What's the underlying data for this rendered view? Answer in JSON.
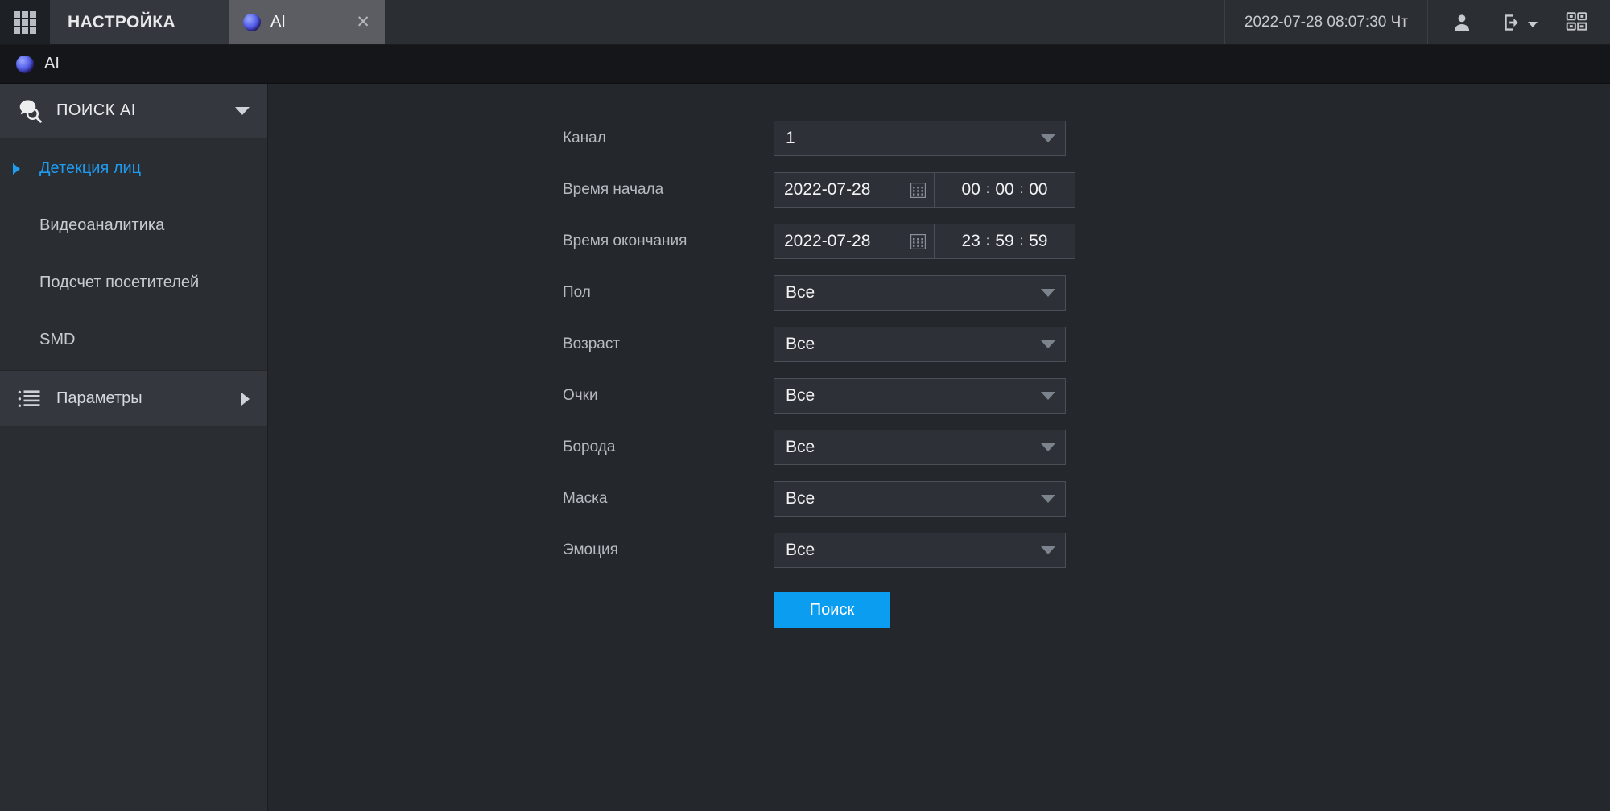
{
  "topbar": {
    "grid_icon": "grid-menu-icon",
    "nav_title": "НАСТРОЙКА",
    "tab": {
      "icon": "ai-gem-icon",
      "label": "AI",
      "close": "✕"
    },
    "clock": "2022-07-28 08:07:30 Чт",
    "icons": [
      {
        "name": "user-icon"
      },
      {
        "name": "logout-icon"
      },
      {
        "name": "qr-code-icon"
      }
    ]
  },
  "breadcrumb": {
    "icon": "ai-gem-icon",
    "label": "AI"
  },
  "sidebar": {
    "header": {
      "icon": "face-search-icon",
      "title": "ПОИСК AI",
      "caret": "chevron-down-icon"
    },
    "items": [
      {
        "label": "Детекция лиц",
        "active": true
      },
      {
        "label": "Видеоаналитика",
        "active": false
      },
      {
        "label": "Подсчет посетителей",
        "active": false
      },
      {
        "label": "SMD",
        "active": false
      }
    ],
    "section": {
      "icon": "list-bullet-icon",
      "label": "Параметры",
      "caret": "chevron-right-icon"
    }
  },
  "form": {
    "channel": {
      "label": "Канал",
      "value": "1"
    },
    "start_time": {
      "label": "Время начала",
      "date": "2022-07-28",
      "hh": "00",
      "mm": "00",
      "ss": "00",
      "sep": ":"
    },
    "end_time": {
      "label": "Время окончания",
      "date": "2022-07-28",
      "hh": "23",
      "mm": "59",
      "ss": "59",
      "sep": ":"
    },
    "filters": [
      {
        "label": "Пол",
        "value": "Все"
      },
      {
        "label": "Возраст",
        "value": "Все"
      },
      {
        "label": "Очки",
        "value": "Все"
      },
      {
        "label": "Борода",
        "value": "Все"
      },
      {
        "label": "Маска",
        "value": "Все"
      },
      {
        "label": "Эмоция",
        "value": "Все"
      }
    ],
    "search_button": "Поиск"
  },
  "colors": {
    "accent_blue": "#0b9df0",
    "active_text": "#1f9bf0",
    "topbar_bg": "#2b2e33",
    "sidebar_bg": "#2a2d32",
    "main_bg": "#24272c",
    "field_bg": "#2d3137",
    "breadcrumb_bg": "#151619"
  }
}
